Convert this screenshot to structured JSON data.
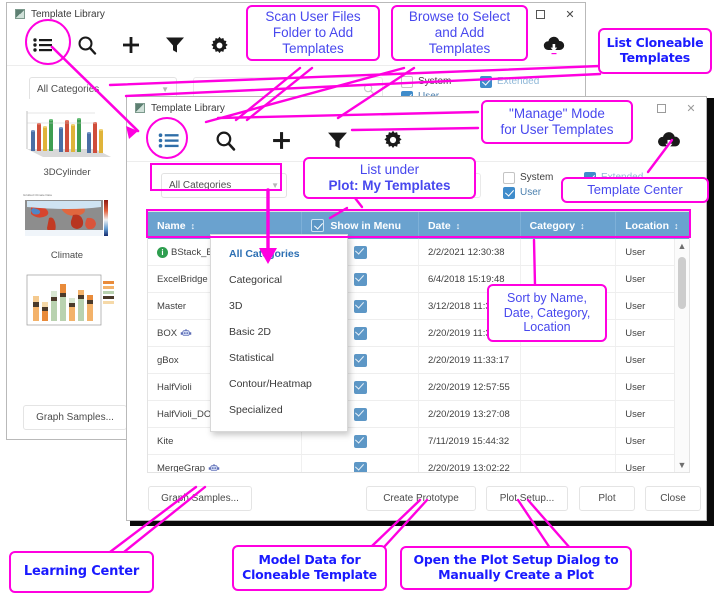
{
  "window_back": {
    "title": "Template Library",
    "toolbar": {
      "list_icon": "list-icon",
      "search_icon": "search-icon",
      "add_icon": "plus-icon",
      "filter_icon": "funnel-icon",
      "settings_icon": "gear-icon",
      "cloud_icon": "cloud-download-icon"
    },
    "controls": {
      "maximize": "maximize-icon",
      "close": "close-icon"
    },
    "category_combo": "All Categories",
    "checkboxes": [
      {
        "label": "System",
        "checked": false,
        "style": "normal"
      },
      {
        "label": "Extended",
        "checked": true,
        "style": "muted"
      },
      {
        "label": "User",
        "checked": true,
        "style": "selected"
      }
    ],
    "thumbnails": [
      {
        "label": "3DCylinder",
        "kind": "3d-bar-chart"
      },
      {
        "label": "Climate",
        "kind": "world-heatmap"
      },
      {
        "label": "",
        "kind": "stacked-column-chart"
      }
    ],
    "graph_samples_button": "Graph Samples..."
  },
  "window_front": {
    "title": "Template Library",
    "toolbar": {
      "list_icon": "list-icon",
      "search_icon": "search-icon",
      "add_icon": "plus-icon",
      "filter_icon": "funnel-icon",
      "settings_icon": "gear-icon",
      "cloud_icon": "cloud-download-icon"
    },
    "controls": {
      "maximize": "maximize-icon",
      "close": "close-icon"
    },
    "category_combo": "All Categories",
    "search_placeholder": "",
    "checkboxes": [
      {
        "label": "System",
        "checked": false,
        "style": "normal"
      },
      {
        "label": "Extended",
        "checked": true,
        "style": "muted"
      },
      {
        "label": "User",
        "checked": true,
        "style": "selected"
      }
    ],
    "table": {
      "columns": [
        {
          "label": "Name",
          "sortable": true
        },
        {
          "label": "Show in Menu",
          "sortable": false,
          "header_checkbox": true
        },
        {
          "label": "Date",
          "sortable": true
        },
        {
          "label": "Category",
          "sortable": true
        },
        {
          "label": "Location",
          "sortable": true
        }
      ],
      "sort_glyph": "↕",
      "rows": [
        {
          "name": "BStack_Big",
          "info_badge": true,
          "bot": false,
          "show_in_menu": true,
          "date": "2/2/2021 12:30:38",
          "category": "",
          "location": "User"
        },
        {
          "name": "ExcelBridge",
          "info_badge": false,
          "bot": false,
          "show_in_menu": true,
          "date": "6/4/2018 15:19:48",
          "category": "",
          "location": "User"
        },
        {
          "name": "Master",
          "info_badge": false,
          "bot": false,
          "show_in_menu": true,
          "date": "3/12/2018 11:38:16",
          "category": "",
          "location": "User"
        },
        {
          "name": "BOX",
          "info_badge": false,
          "bot": true,
          "show_in_menu": true,
          "date": "2/20/2019 11:37:14",
          "category": "",
          "location": "User"
        },
        {
          "name": "gBox",
          "info_badge": false,
          "bot": false,
          "show_in_menu": true,
          "date": "2/20/2019 11:33:17",
          "category": "",
          "location": "User"
        },
        {
          "name": "HalfVioli",
          "info_badge": false,
          "bot": false,
          "show_in_menu": true,
          "date": "2/20/2019 12:57:55",
          "category": "",
          "location": "User"
        },
        {
          "name": "HalfVioli_DOTS",
          "info_badge": false,
          "bot": false,
          "show_in_menu": true,
          "date": "2/20/2019 13:27:08",
          "category": "",
          "location": "User"
        },
        {
          "name": "Kite",
          "info_badge": false,
          "bot": false,
          "show_in_menu": true,
          "date": "7/11/2019 15:44:32",
          "category": "",
          "location": "User"
        },
        {
          "name": "MergeGrap",
          "info_badge": false,
          "bot": true,
          "show_in_menu": true,
          "date": "2/20/2019 13:02:22",
          "category": "",
          "location": "User"
        }
      ],
      "scrollbar": {
        "up_arrow": "chevron-up-icon",
        "down_arrow": "chevron-down-icon"
      }
    },
    "category_dropdown": {
      "header": "All Categories",
      "items": [
        "Categorical",
        "3D",
        "Basic 2D",
        "Statistical",
        "Contour/Heatmap",
        "Specialized"
      ]
    },
    "buttons": {
      "graph_samples": "Graph Samples...",
      "create_prototype": "Create Prototype",
      "plot_setup": "Plot Setup...",
      "plot": "Plot",
      "close": "Close"
    }
  },
  "annotations": {
    "accent_color": "#ff00e0",
    "text_color_plain": "#4848ee",
    "text_color_heavy": "#1a1aff",
    "callouts": [
      {
        "id": "scan-user-files",
        "lines": [
          "Scan User Files",
          "Folder to Add",
          "Templates"
        ],
        "style": "plain"
      },
      {
        "id": "browse-select",
        "lines": [
          "Browse to Select",
          "and Add",
          "Templates"
        ],
        "style": "plain"
      },
      {
        "id": "list-cloneable",
        "lines": [
          "List Cloneable",
          "Templates"
        ],
        "style": "heavy"
      },
      {
        "id": "manage-mode",
        "lines": [
          "\"Manage\" Mode",
          "for User Templates"
        ],
        "style": "plain"
      },
      {
        "id": "list-under-plot",
        "lines": [
          "List under",
          "Plot: My Templates"
        ],
        "style": "plain",
        "bold_lines": [
          1
        ]
      },
      {
        "id": "template-center",
        "lines": [
          "Template Center"
        ],
        "style": "plain"
      },
      {
        "id": "sort-by",
        "lines": [
          "Sort by Name,",
          "Date, Category,",
          "Location"
        ],
        "style": "plain"
      },
      {
        "id": "learning-center",
        "lines": [
          "Learning Center"
        ],
        "style": "heavy"
      },
      {
        "id": "model-data",
        "lines": [
          "Model Data for",
          "Cloneable Template"
        ],
        "style": "heavy"
      },
      {
        "id": "open-plot-setup",
        "lines": [
          "Open the Plot Setup Dialog to",
          "Manually Create a Plot"
        ],
        "style": "heavy"
      }
    ]
  }
}
